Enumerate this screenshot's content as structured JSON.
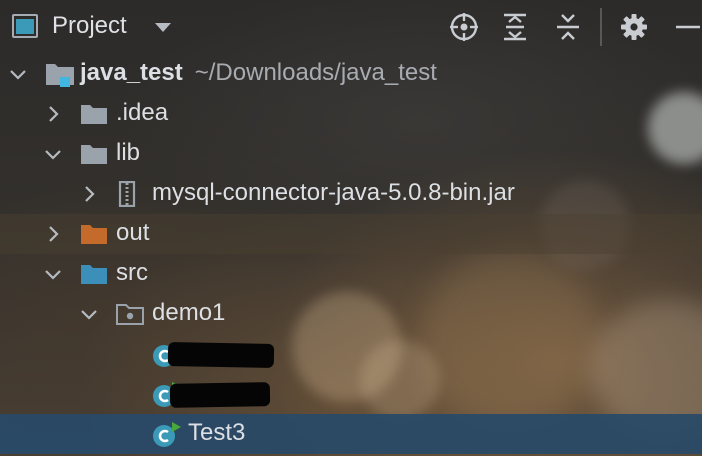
{
  "header": {
    "title": "Project",
    "icons": {
      "panel": "project-panel-icon",
      "dropdown": "chevron-down-icon",
      "locate": "locate-icon",
      "expand": "expand-all-icon",
      "collapse": "collapse-all-icon",
      "settings": "gear-icon",
      "hide": "minus-icon"
    }
  },
  "colors": {
    "selection": "#284a68",
    "folder": "#9aa3ab",
    "excluded_folder": "#c46a2a",
    "source_folder": "#3b8fb8",
    "java_class": "#3b9ab8",
    "run_badge": "#49a83a",
    "module_badge": "#40b6e0"
  },
  "tree": {
    "root": {
      "name": "java_test",
      "path": "~/Downloads/java_test"
    },
    "items": [
      {
        "label": ".idea"
      },
      {
        "label": "lib"
      },
      {
        "label": "mysql-connector-java-5.0.8-bin.jar"
      },
      {
        "label": "out"
      },
      {
        "label": "src"
      },
      {
        "label": "demo1"
      },
      {
        "label": ""
      },
      {
        "label": ""
      },
      {
        "label": "Test3"
      }
    ]
  }
}
